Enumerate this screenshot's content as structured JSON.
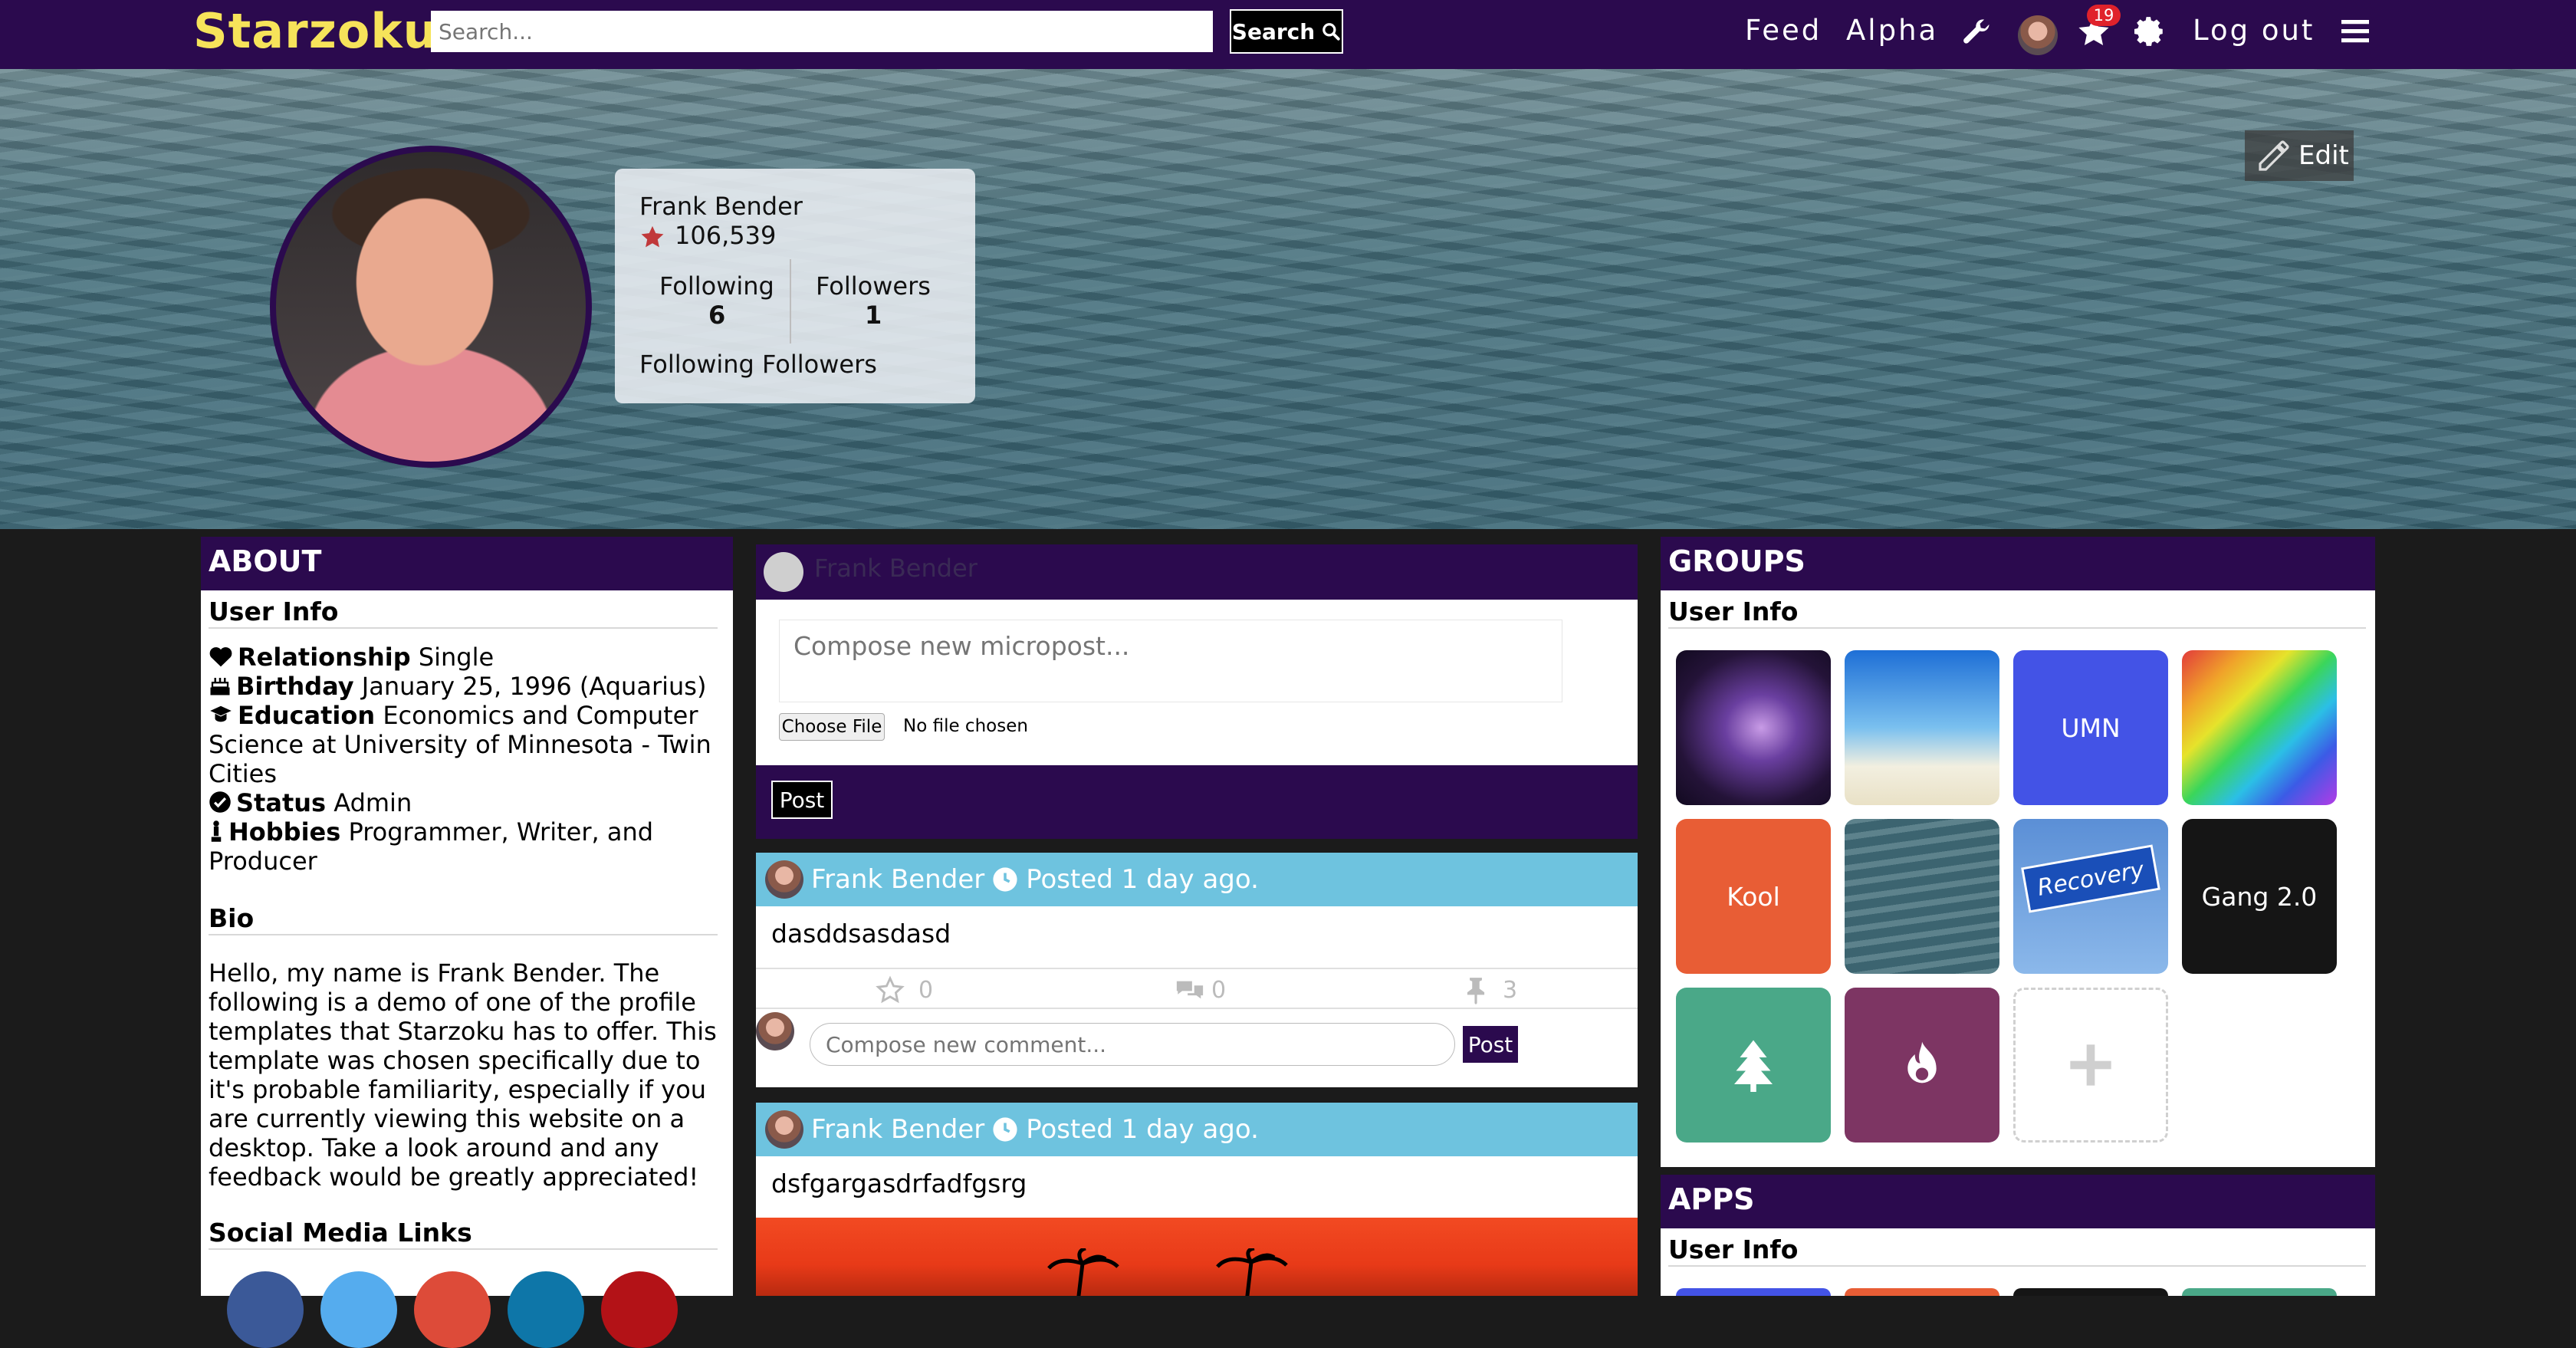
{
  "header": {
    "logo": "Starzoku",
    "search_placeholder": "Search...",
    "search_button": "Search",
    "nav": {
      "feed": "Feed",
      "alpha": "Alpha",
      "logout": "Log out"
    },
    "notification_count": "19"
  },
  "profile": {
    "name": "Frank Bender",
    "stars": "106,539",
    "following_label": "Following",
    "following_count": "6",
    "followers_label": "Followers",
    "followers_count": "1",
    "footer_text": "Following Followers",
    "edit_label": "Edit"
  },
  "about": {
    "title": "ABOUT",
    "user_info_title": "User Info",
    "relationship_label": "Relationship",
    "relationship_value": "Single",
    "birthday_label": "Birthday",
    "birthday_value": "January 25, 1996 (Aquarius)",
    "education_label": "Education",
    "education_value": "Economics and Computer Science at University of Minnesota - Twin Cities",
    "status_label": "Status",
    "status_value": "Admin",
    "hobbies_label": "Hobbies",
    "hobbies_value": "Programmer, Writer, and Producer",
    "bio_title": "Bio",
    "bio_text": "Hello, my name is Frank Bender. The following is a demo of one of the profile templates that Starzoku has to offer. This template was chosen specifically due to it's probable familiarity, especially if you are currently viewing this website on a desktop. Take a look around and any feedback would be greatly appreciated!",
    "social_title": "Social Media Links"
  },
  "composer": {
    "author": "Frank Bender",
    "placeholder": "Compose new micropost...",
    "choose_file": "Choose File",
    "no_file": "No file chosen",
    "post_button": "Post"
  },
  "posts": [
    {
      "author": "Frank Bender",
      "time": "Posted 1 day ago.",
      "content": "dasddsasdasd",
      "stars": "0",
      "comments": "0",
      "pins": "3",
      "comment_placeholder": "Compose new comment...",
      "comment_button": "Post"
    },
    {
      "author": "Frank Bender",
      "time": "Posted 1 day ago.",
      "content": "dsfgargasdrfadfgsrg"
    }
  ],
  "groups": {
    "title": "GROUPS",
    "subtitle": "User Info",
    "tiles": [
      "UMN",
      "Kool",
      "Recovery",
      "Gang 2.0"
    ]
  },
  "apps": {
    "title": "APPS",
    "subtitle": "User Info"
  },
  "colors": {
    "brand_purple": "#2b0a4e",
    "logo_yellow": "#f6e35a",
    "post_header_blue": "#6ec3df",
    "badge_red": "#e0222b"
  }
}
